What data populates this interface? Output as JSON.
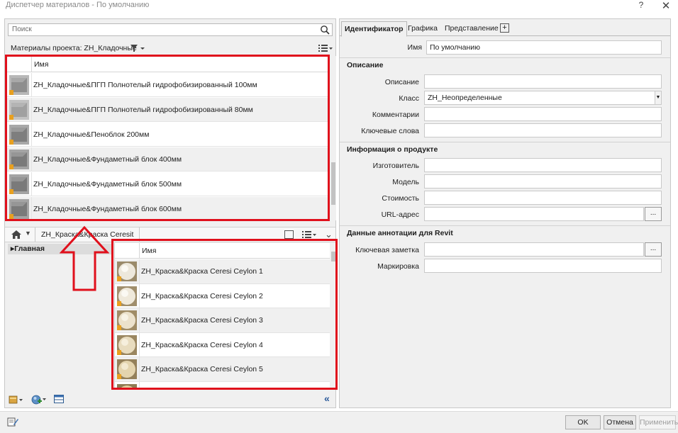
{
  "window": {
    "title": "Диспетчер материалов - По умолчанию",
    "help_glyph": "?",
    "close_glyph": "✕"
  },
  "left": {
    "search_placeholder": "Поиск",
    "project_label": "Материалы проекта: ZH_Кладочные",
    "grid_header": "Имя",
    "project_materials": [
      "ZH_Кладочные&ПГП Полнотелый гидрофобизированный 100мм",
      "ZH_Кладочные&ПГП Полнотелый гидрофобизированный 80мм",
      "ZH_Кладочные&Пеноблок 200мм",
      "ZH_Кладочные&Фундаметный блок 400мм",
      "ZH_Кладочные&Фундаметный блок 500мм",
      "ZH_Кладочные&Фундаметный блок 600мм"
    ],
    "breadcrumb": "ZH_Краска&Краска Ceresit",
    "tree_item": "▸Главная",
    "library_header": "Имя",
    "library_materials": [
      "ZH_Краска&Краска Ceresi Ceylon 1",
      "ZH_Краска&Краска Ceresi Ceylon 2",
      "ZH_Краска&Краска Ceresi Ceylon 3",
      "ZH_Краска&Краска Ceresi Ceylon 4",
      "ZH_Краска&Краска Ceresi Ceylon 5"
    ],
    "collapse_glyph": "«"
  },
  "right": {
    "tabs": [
      "Идентификатор",
      "Графика",
      "Представление"
    ],
    "add_tab_glyph": "+",
    "name_label": "Имя",
    "name_value": "По умолчанию",
    "sections": {
      "description": "Описание",
      "product": "Информация о продукте",
      "revit": "Данные аннотации для Revit"
    },
    "fields": {
      "description": "Описание",
      "class": "Класс",
      "class_value": "ZH_Неопределенные",
      "comments": "Комментарии",
      "keywords": "Ключевые слова",
      "manufacturer": "Изготовитель",
      "model": "Модель",
      "cost": "Стоимость",
      "url": "URL-адрес",
      "keynote": "Ключевая заметка",
      "mark": "Маркировка"
    },
    "browse_glyph": "..."
  },
  "buttons": {
    "ok": "OK",
    "cancel": "Отмена",
    "apply": "Применить"
  },
  "colors": {
    "highlight": "#e0101c",
    "panel": "#f0f0f0",
    "row_alt": "#f0f0f0"
  }
}
